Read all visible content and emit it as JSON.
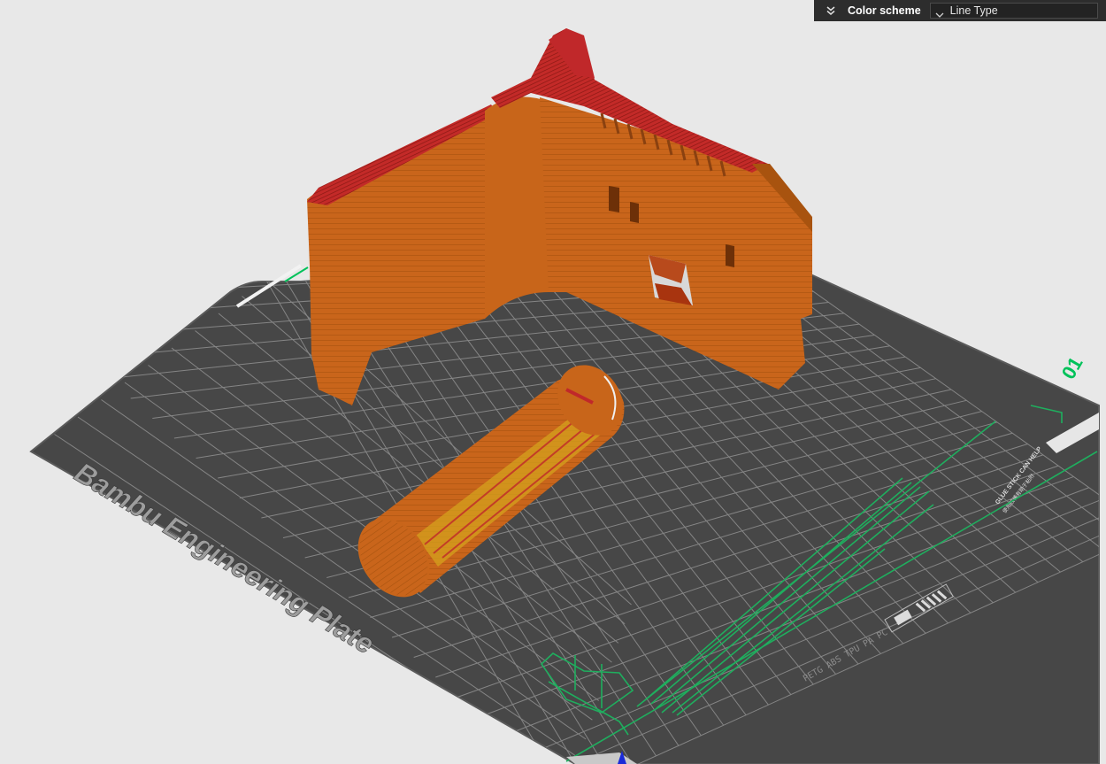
{
  "color_scheme_panel": {
    "label": "Color scheme",
    "selected": "Line Type",
    "collapse_icon": "chevron-double-down-icon",
    "dropdown_icon": "chevron-down-icon"
  },
  "build_plate": {
    "name": "Bambu Engineering Plate",
    "plate_number": "01",
    "marking_materials": "PETG ABS TPU PA PC",
    "marking_glue": "GLUE STICK CAN HELP",
    "marking_chinese": "使用胶棒有助于粘附"
  },
  "colors": {
    "background": "#e8e8e8",
    "plate": "#4a4a4a",
    "grid": "#9a9a9a",
    "outer_wall": "#c8671a",
    "top_surface": "#c0282a",
    "travel_lines": "#1fae5e",
    "accent_green": "#00c25a",
    "panel_bg": "#2d2d2d"
  }
}
